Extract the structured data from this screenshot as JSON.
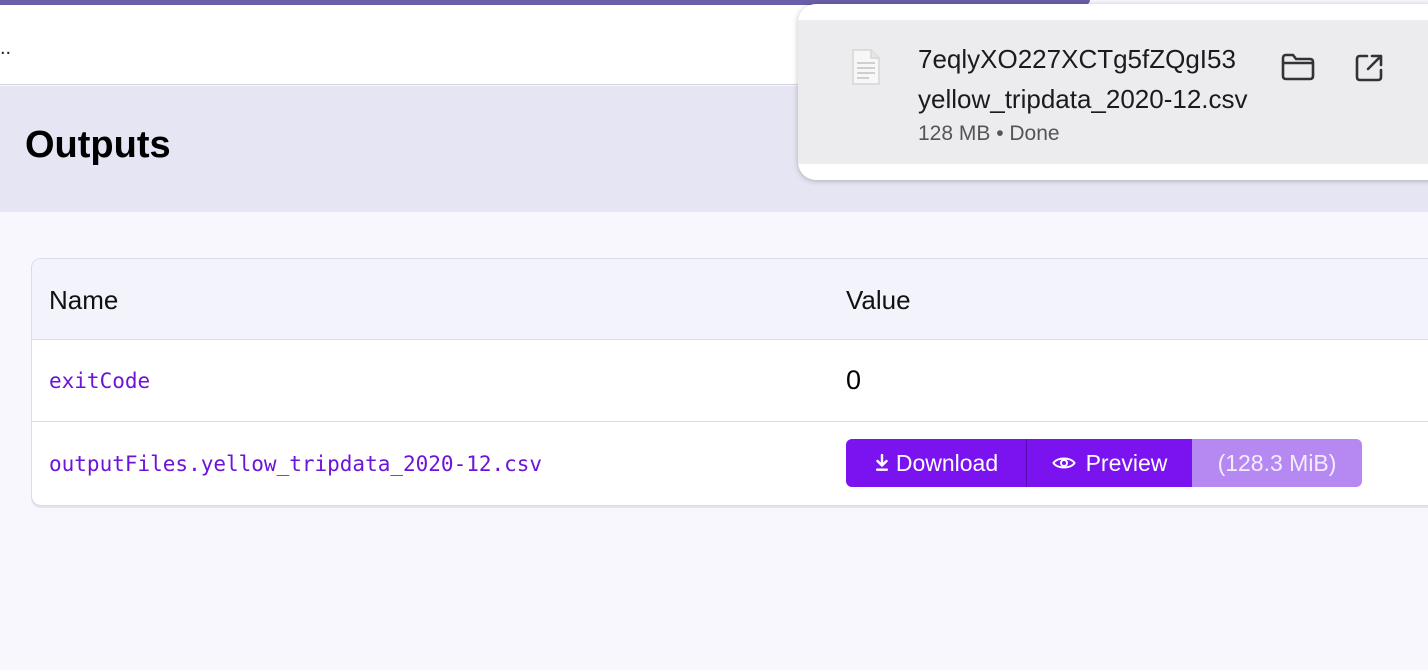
{
  "topbar": {
    "text": ".."
  },
  "header": {
    "title": "Outputs"
  },
  "table": {
    "columns": [
      "Name",
      "Value"
    ],
    "rows": [
      {
        "name": "exitCode",
        "value": "0"
      },
      {
        "name": "outputFiles.yellow_tripdata_2020-12.csv"
      }
    ],
    "actions": {
      "download_label": "Download",
      "preview_label": "Preview",
      "size_label": "(128.3 MiB)"
    }
  },
  "download_popup": {
    "name_line1": "7eqlyXO227XCTg5fZQgI53",
    "name_line2": "yellow_tripdata_2020-12.csv",
    "status": "128 MB • Done",
    "icons": [
      "file-icon",
      "folder-icon",
      "open-external-icon"
    ]
  },
  "colors": {
    "accent": "#7a13f0",
    "accent_light": "#b688f2",
    "header_band": "#e6e5f3",
    "link_text": "#6d14d8"
  }
}
